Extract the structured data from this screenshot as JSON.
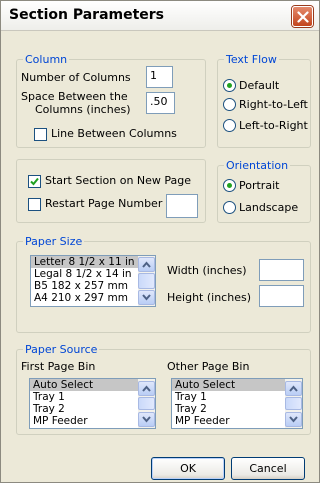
{
  "window": {
    "title": "Section Parameters",
    "close_icon": "close-icon"
  },
  "column": {
    "legend": "Column",
    "num_columns_label": "Number of Columns",
    "num_columns_value": "1",
    "space_label_line1": "Space Between the",
    "space_label_line2": "Columns (inches)",
    "space_value": ".50",
    "line_between_label": "Line Between Columns",
    "line_between_checked": false
  },
  "text_flow": {
    "legend": "Text Flow",
    "options": [
      "Default",
      "Right-to-Left",
      "Left-to-Right"
    ],
    "selected": "Default"
  },
  "section": {
    "start_new_page_label": "Start Section on New Page",
    "start_new_page_checked": true,
    "restart_page_label": "Restart Page Number at",
    "restart_page_checked": false,
    "restart_page_value": ""
  },
  "orientation": {
    "legend": "Orientation",
    "options": [
      "Portrait",
      "Landscape"
    ],
    "selected": "Portrait"
  },
  "paper_size": {
    "legend": "Paper Size",
    "items": [
      "Letter 8 1/2 x 11 in",
      "Legal 8 1/2 x 14 in",
      "B5 182 x 257 mm",
      "A4 210 x 297 mm"
    ],
    "selected": "Letter 8 1/2 x 11 in",
    "width_label": "Width (inches)",
    "width_value": "",
    "height_label": "Height (inches)",
    "height_value": ""
  },
  "paper_source": {
    "legend": "Paper Source",
    "first_bin_label": "First Page Bin",
    "first_bin_items": [
      "Auto Select",
      "Tray 1",
      "Tray 2",
      "MP Feeder"
    ],
    "first_bin_selected": "Auto Select",
    "other_bin_label": "Other Page Bin",
    "other_bin_items": [
      "Auto Select",
      "Tray 1",
      "Tray 2",
      "MP Feeder"
    ],
    "other_bin_selected": "Auto Select"
  },
  "buttons": {
    "ok": "OK",
    "cancel": "Cancel"
  },
  "colors": {
    "group_legend": "#0046d5",
    "dialog_bg": "#ece9d8",
    "radio_dot": "#21a121",
    "close_button": "#c2441d"
  }
}
